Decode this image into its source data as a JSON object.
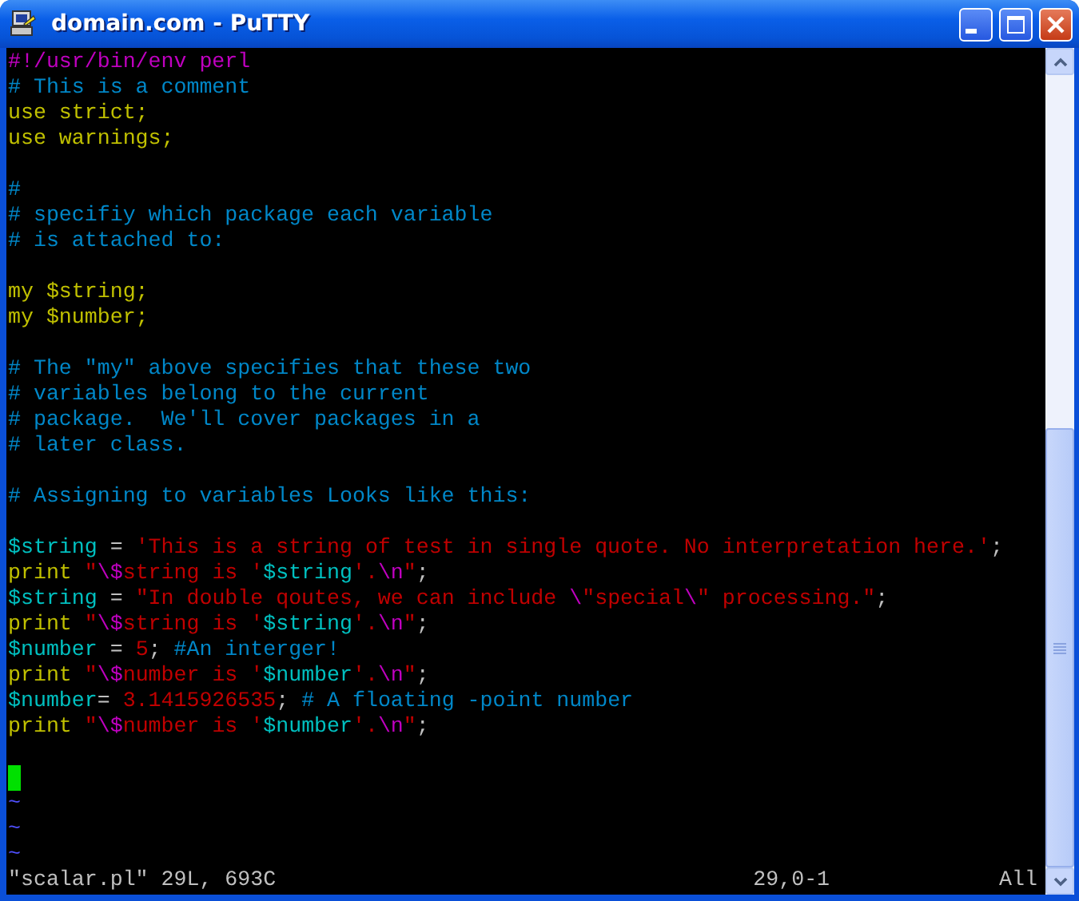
{
  "window": {
    "title": "domain.com - PuTTY"
  },
  "lines": [
    {
      "kind": "code",
      "segments": [
        {
          "text": "#!/usr/bin/env perl",
          "kind": "special"
        }
      ]
    },
    {
      "kind": "code",
      "segments": [
        {
          "text": "# This is a comment",
          "kind": "comment"
        }
      ]
    },
    {
      "kind": "code",
      "segments": [
        {
          "text": "use strict;",
          "kind": "keyword"
        }
      ]
    },
    {
      "kind": "code",
      "segments": [
        {
          "text": "use warnings;",
          "kind": "keyword"
        }
      ]
    },
    {
      "kind": "blank"
    },
    {
      "kind": "code",
      "segments": [
        {
          "text": "#",
          "kind": "comment"
        }
      ]
    },
    {
      "kind": "code",
      "segments": [
        {
          "text": "# specifiy which package each variable",
          "kind": "comment"
        }
      ]
    },
    {
      "kind": "code",
      "segments": [
        {
          "text": "# is attached to:",
          "kind": "comment"
        }
      ]
    },
    {
      "kind": "blank"
    },
    {
      "kind": "code",
      "segments": [
        {
          "text": "my $string;",
          "kind": "keyword"
        }
      ]
    },
    {
      "kind": "code",
      "segments": [
        {
          "text": "my $number;",
          "kind": "keyword"
        }
      ]
    },
    {
      "kind": "blank"
    },
    {
      "kind": "code",
      "segments": [
        {
          "text": "# The \"my\" above specifies that these two",
          "kind": "comment"
        }
      ]
    },
    {
      "kind": "code",
      "segments": [
        {
          "text": "# variables belong to the current",
          "kind": "comment"
        }
      ]
    },
    {
      "kind": "code",
      "segments": [
        {
          "text": "# package.  We'll cover packages in a",
          "kind": "comment"
        }
      ]
    },
    {
      "kind": "code",
      "segments": [
        {
          "text": "# later class.",
          "kind": "comment"
        }
      ]
    },
    {
      "kind": "blank"
    },
    {
      "kind": "code",
      "segments": [
        {
          "text": "# Assigning to variables Looks like this:",
          "kind": "comment"
        }
      ]
    },
    {
      "kind": "blank"
    },
    {
      "kind": "code",
      "segments": [
        {
          "text": "$string",
          "kind": "variable"
        },
        {
          "text": " = ",
          "kind": "plain"
        },
        {
          "text": "'This is a string of test in single quote. No interpretation here.'",
          "kind": "string"
        },
        {
          "text": ";",
          "kind": "plain"
        }
      ]
    },
    {
      "kind": "code",
      "segments": [
        {
          "text": "print ",
          "kind": "keyword"
        },
        {
          "text": "\"",
          "kind": "string"
        },
        {
          "text": "\\$",
          "kind": "special"
        },
        {
          "text": "string is '",
          "kind": "string"
        },
        {
          "text": "$string",
          "kind": "variable"
        },
        {
          "text": "'.",
          "kind": "string"
        },
        {
          "text": "\\n",
          "kind": "special"
        },
        {
          "text": "\"",
          "kind": "string"
        },
        {
          "text": ";",
          "kind": "plain"
        }
      ]
    },
    {
      "kind": "code",
      "segments": [
        {
          "text": "$string",
          "kind": "variable"
        },
        {
          "text": " = ",
          "kind": "plain"
        },
        {
          "text": "\"In double qoutes, we can include ",
          "kind": "string"
        },
        {
          "text": "\\",
          "kind": "special"
        },
        {
          "text": "\"special",
          "kind": "string"
        },
        {
          "text": "\\",
          "kind": "special"
        },
        {
          "text": "\" processing.\"",
          "kind": "string"
        },
        {
          "text": ";",
          "kind": "plain"
        }
      ]
    },
    {
      "kind": "code",
      "segments": [
        {
          "text": "print ",
          "kind": "keyword"
        },
        {
          "text": "\"",
          "kind": "string"
        },
        {
          "text": "\\$",
          "kind": "special"
        },
        {
          "text": "string is '",
          "kind": "string"
        },
        {
          "text": "$string",
          "kind": "variable"
        },
        {
          "text": "'.",
          "kind": "string"
        },
        {
          "text": "\\n",
          "kind": "special"
        },
        {
          "text": "\"",
          "kind": "string"
        },
        {
          "text": ";",
          "kind": "plain"
        }
      ]
    },
    {
      "kind": "code",
      "segments": [
        {
          "text": "$number",
          "kind": "variable"
        },
        {
          "text": " = ",
          "kind": "plain"
        },
        {
          "text": "5",
          "kind": "string"
        },
        {
          "text": "; ",
          "kind": "plain"
        },
        {
          "text": "#An interger!",
          "kind": "comment"
        }
      ]
    },
    {
      "kind": "code",
      "segments": [
        {
          "text": "print ",
          "kind": "keyword"
        },
        {
          "text": "\"",
          "kind": "string"
        },
        {
          "text": "\\$",
          "kind": "special"
        },
        {
          "text": "number is '",
          "kind": "string"
        },
        {
          "text": "$number",
          "kind": "variable"
        },
        {
          "text": "'.",
          "kind": "string"
        },
        {
          "text": "\\n",
          "kind": "special"
        },
        {
          "text": "\"",
          "kind": "string"
        },
        {
          "text": ";",
          "kind": "plain"
        }
      ]
    },
    {
      "kind": "code",
      "segments": [
        {
          "text": "$number",
          "kind": "variable"
        },
        {
          "text": "= ",
          "kind": "plain"
        },
        {
          "text": "3.1415926535",
          "kind": "string"
        },
        {
          "text": "; ",
          "kind": "plain"
        },
        {
          "text": "# A floating -point number",
          "kind": "comment"
        }
      ]
    },
    {
      "kind": "code",
      "segments": [
        {
          "text": "print ",
          "kind": "keyword"
        },
        {
          "text": "\"",
          "kind": "string"
        },
        {
          "text": "\\$",
          "kind": "special"
        },
        {
          "text": "number is '",
          "kind": "string"
        },
        {
          "text": "$number",
          "kind": "variable"
        },
        {
          "text": "'.",
          "kind": "string"
        },
        {
          "text": "\\n",
          "kind": "special"
        },
        {
          "text": "\"",
          "kind": "string"
        },
        {
          "text": ";",
          "kind": "plain"
        }
      ]
    },
    {
      "kind": "blank"
    },
    {
      "kind": "cursor"
    },
    {
      "kind": "filler",
      "text": "~"
    },
    {
      "kind": "filler",
      "text": "~"
    },
    {
      "kind": "filler",
      "text": "~"
    }
  ],
  "status_bar": {
    "file_info": "\"scalar.pl\" 29L, 693C",
    "position": "29,0-1",
    "scroll": "All"
  }
}
